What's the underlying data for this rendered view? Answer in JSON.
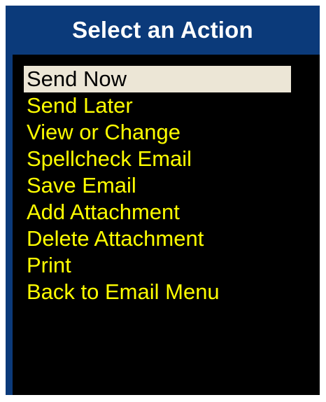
{
  "dialog": {
    "title": "Select an Action",
    "selected_index": 0,
    "items": [
      {
        "label": "Send Now"
      },
      {
        "label": "Send Later"
      },
      {
        "label": "View or Change"
      },
      {
        "label": "Spellcheck Email"
      },
      {
        "label": "Save Email"
      },
      {
        "label": "Add Attachment"
      },
      {
        "label": "Delete Attachment"
      },
      {
        "label": "Print"
      },
      {
        "label": "Back to Email Menu"
      }
    ]
  },
  "colors": {
    "title_bar": "#0b3a7a",
    "title_text": "#ffffff",
    "panel_bg": "#000000",
    "item_text": "#ffff00",
    "selected_bg": "#ece6d6",
    "selected_text": "#000000"
  }
}
